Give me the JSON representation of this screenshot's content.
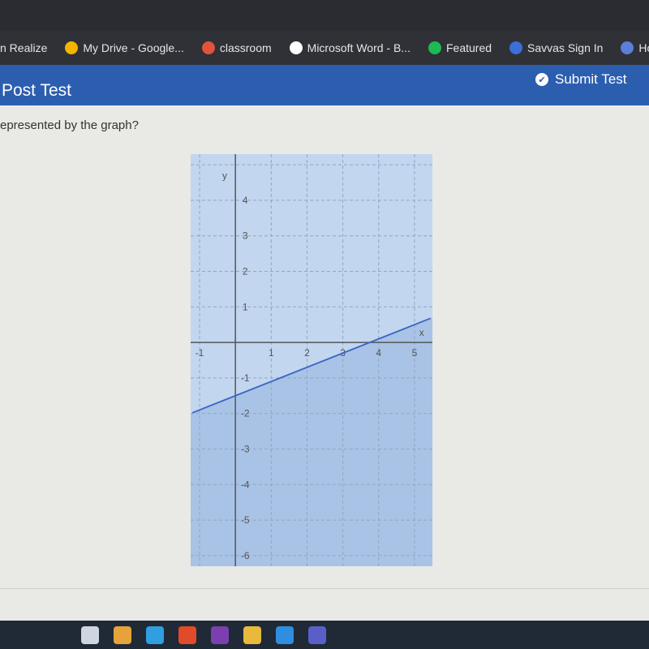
{
  "browser": {
    "bookmarks": [
      {
        "label": "n Realize",
        "icon": "realize-icon",
        "color": "#2f3136"
      },
      {
        "label": "My Drive - Google...",
        "icon": "google-drive-icon",
        "color": "#f4b400"
      },
      {
        "label": "classroom",
        "icon": "classroom-icon",
        "color": "#e2533c"
      },
      {
        "label": "Microsoft Word - B...",
        "icon": "globe-icon",
        "color": "#ffffff"
      },
      {
        "label": "Featured",
        "icon": "spotify-icon",
        "color": "#1db954"
      },
      {
        "label": "Savvas Sign In",
        "icon": "savvas-icon",
        "color": "#3a6fd8"
      },
      {
        "label": "Ho",
        "icon": "s-circle-icon",
        "color": "#5b7fd8"
      }
    ]
  },
  "header": {
    "title": "Post Test",
    "submit_label": "Submit Test"
  },
  "question": {
    "text": "epresented by the graph?"
  },
  "colors": {
    "header": "#2c5eb0",
    "shade": "#a9c3e6",
    "line": "#3a66c4"
  },
  "chart_data": {
    "type": "line",
    "title": "",
    "xlabel": "x",
    "ylabel": "y",
    "xlim": [
      -1.25,
      5.5
    ],
    "ylim": [
      -6.3,
      5.3
    ],
    "x_ticks": [
      "-1",
      "1",
      "2",
      "3",
      "4",
      "5"
    ],
    "y_ticks": [
      "4",
      "3",
      "2",
      "1",
      "-1",
      "-2",
      "-3",
      "-4",
      "-5",
      "-6"
    ],
    "grid": true,
    "line": {
      "slope": 0.4,
      "intercept": -1.5,
      "style": "solid",
      "points": [
        [
          0,
          -1.5
        ],
        [
          3.75,
          0
        ]
      ]
    },
    "shaded_region": "below line"
  },
  "taskbar": {
    "icons": [
      "task-view-icon",
      "store-icon",
      "edge-icon",
      "chrome-icon",
      "onenote-icon",
      "file-explorer-icon",
      "ie-icon",
      "teams-icon"
    ]
  }
}
